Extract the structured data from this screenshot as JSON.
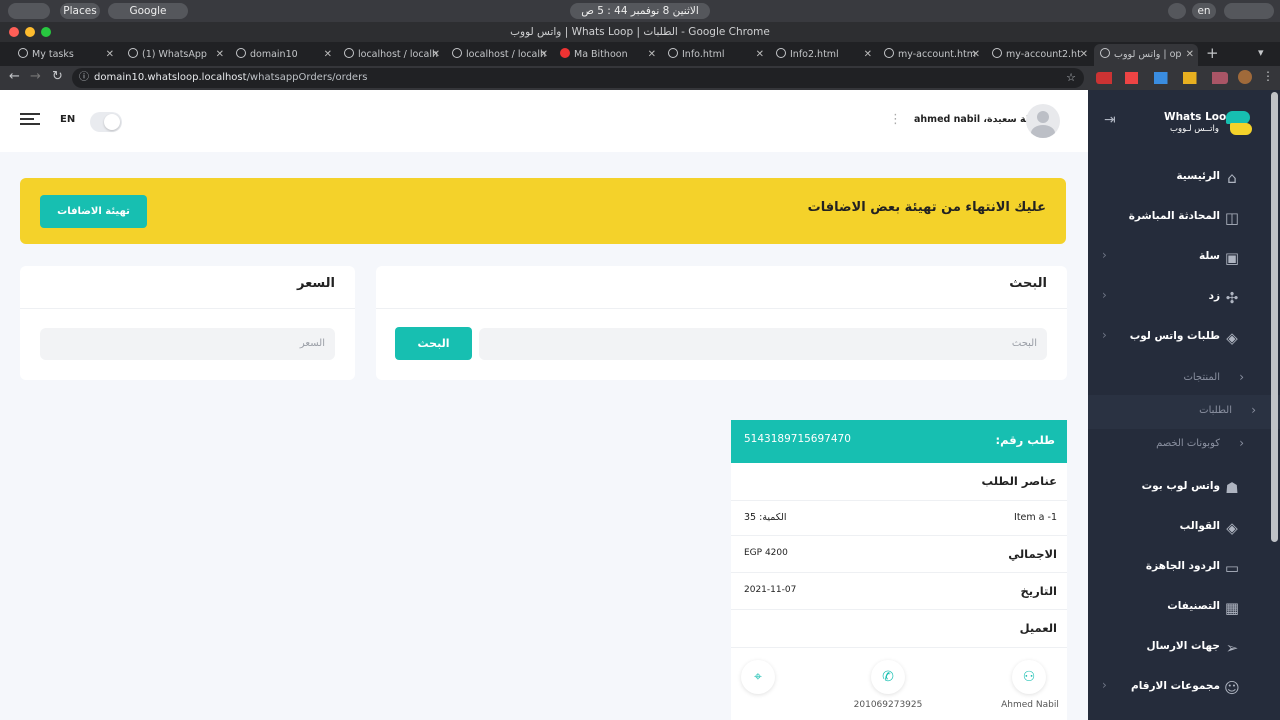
{
  "os": {
    "places": "Places",
    "app": "Google Chrome",
    "clock": "الاثنين 8 نوفمبر  44 : 5 ص",
    "lang": "en"
  },
  "window": {
    "title": "واتس لووب | Whats Loop | الطلبات - Google Chrome"
  },
  "tabs": [
    {
      "label": "My tasks"
    },
    {
      "label": "(1) WhatsApp"
    },
    {
      "label": "domain10"
    },
    {
      "label": "localhost / localh"
    },
    {
      "label": "localhost / localh"
    },
    {
      "label": "Ma Bithoon"
    },
    {
      "label": "Info.html"
    },
    {
      "label": "Info2.html"
    },
    {
      "label": "my-account.htm"
    },
    {
      "label": "my-account2.ht"
    },
    {
      "label": "واتس لووب | op"
    }
  ],
  "address": {
    "host": "domain10.whatsloop.localhost",
    "path": "/whatsappOrders/orders"
  },
  "header": {
    "lang": "EN",
    "greeting": "ليلة سعيدة، ahmed nabil"
  },
  "banner": {
    "text": "عليك الانتهاء من تهيئة بعض الاضافات",
    "button": "تهيئة الاضافات"
  },
  "search": {
    "title": "البحث",
    "placeholder": "البحث",
    "button": "البحث"
  },
  "price": {
    "title": "السعر",
    "placeholder": "السعر"
  },
  "order": {
    "label": "طلب رقم:",
    "number": "5143189715697470",
    "items_title": "عناصر الطلب",
    "item_name": "Item a -1",
    "qty": "الكمية: 35",
    "total_label": "الاجمالي",
    "total": "EGP 4200",
    "date_label": "التاريخ",
    "date": "2021-11-07",
    "customer_label": "العميل",
    "customer_name": "Ahmed Nabil",
    "phone": "201069273925"
  },
  "sidebar": {
    "brand_en": "Whats Loop",
    "brand_ar": "واتــس لـووب",
    "items": [
      {
        "label": "الرئيسية",
        "icon": "home-icon",
        "glyph": "⌂"
      },
      {
        "label": "المحادثة المباشرة",
        "icon": "chat-pulse-icon",
        "glyph": "◫"
      },
      {
        "label": "سلة",
        "icon": "basket-icon",
        "glyph": "▣"
      },
      {
        "label": "زد",
        "icon": "nodes-icon",
        "glyph": "✣"
      },
      {
        "label": "طلبات واتس لوب",
        "icon": "layers-icon",
        "glyph": "◈"
      }
    ],
    "subs": [
      {
        "label": "المنتجات"
      },
      {
        "label": "الطلبات"
      },
      {
        "label": "كوبونات الخصم"
      }
    ],
    "items2": [
      {
        "label": "واتس لوب بوت",
        "icon": "bot-icon",
        "glyph": "☗"
      },
      {
        "label": "القوالب",
        "icon": "templates-icon",
        "glyph": "◈"
      },
      {
        "label": "الردود الجاهزة",
        "icon": "replies-icon",
        "glyph": "▭"
      },
      {
        "label": "التصنيفات",
        "icon": "categories-icon",
        "glyph": "▦"
      },
      {
        "label": "جهات الارسال",
        "icon": "send-icon",
        "glyph": "➢"
      },
      {
        "label": "مجموعات الارقام",
        "icon": "contacts-group-icon",
        "glyph": "☺"
      }
    ]
  }
}
